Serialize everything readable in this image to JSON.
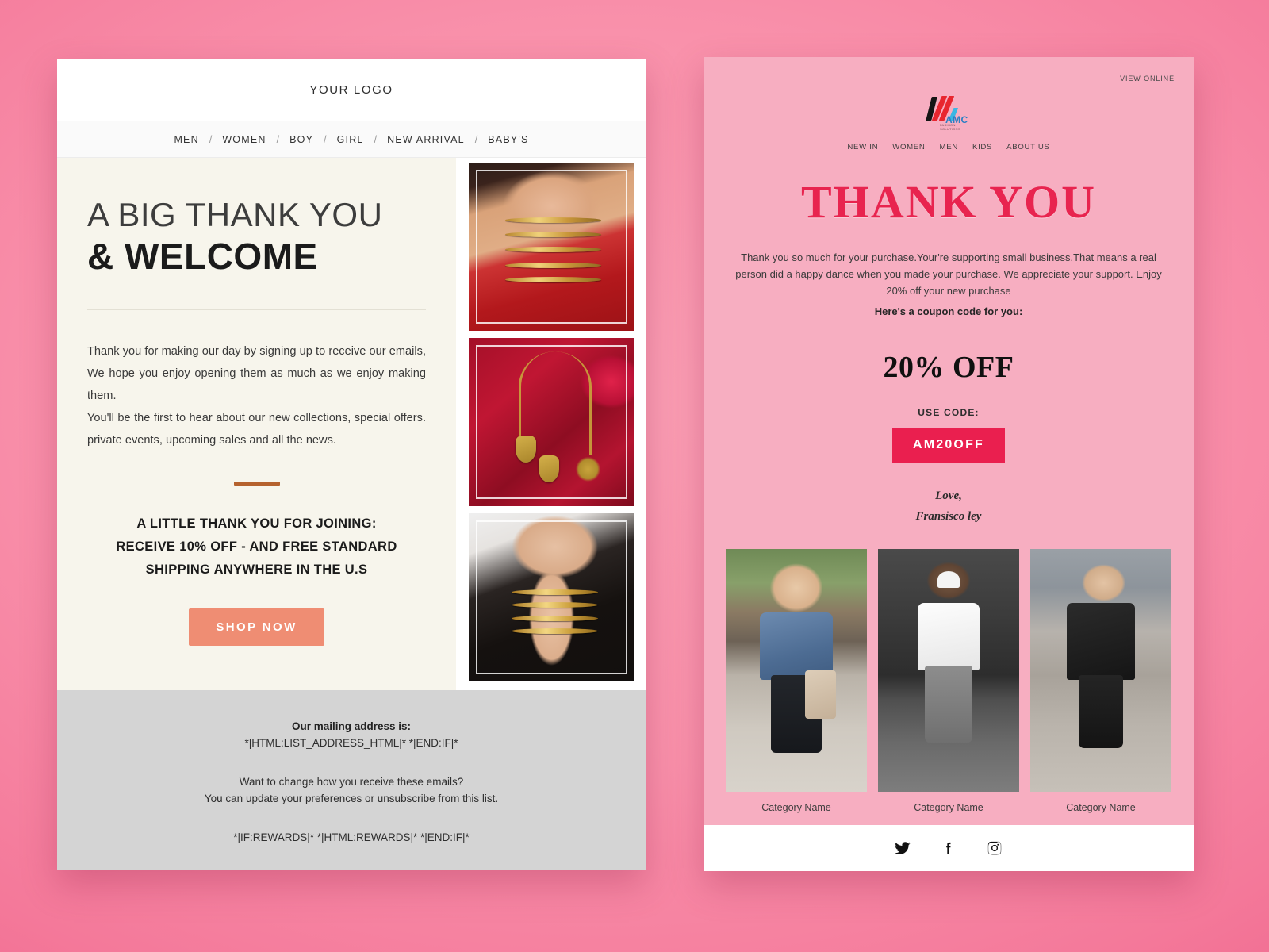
{
  "left_email": {
    "logo_text": "YOUR LOGO",
    "nav": [
      {
        "label": "MEN"
      },
      {
        "label": "WOMEN"
      },
      {
        "label": "BOY"
      },
      {
        "label": "GIRL"
      },
      {
        "label": "NEW ARRIVAL"
      },
      {
        "label": "BABY'S"
      }
    ],
    "nav_separator": "/",
    "headline_line1": "A BIG THANK YOU",
    "headline_line2": "& WELCOME",
    "paragraph_1": "Thank you for making our day by signing up to receive our emails, We hope you enjoy opening them as much as we enjoy making them.",
    "paragraph_2": "You'll be the first to hear about our new collections, special offers. private events, upcoming sales and all the news.",
    "offer_line1": "A LITTLE THANK YOU FOR JOINING:",
    "offer_line2": "RECEIVE 10% OFF - AND FREE STANDARD",
    "offer_line3": "SHIPPING ANYWHERE IN THE U.S",
    "shop_button": "SHOP NOW",
    "thumbnails": [
      {
        "alt": "gold-layered-necklace-red-dress"
      },
      {
        "alt": "indian-kundan-jewellery-set"
      },
      {
        "alt": "gold-chain-necklace-black-blazer"
      }
    ],
    "footer": {
      "mailing_label": "Our mailing address is:",
      "address_merge_tag": "*|HTML:LIST_ADDRESS_HTML|* *|END:IF|*",
      "pref_line1": "Want to change how you receive these emails?",
      "pref_line2": "You can update your preferences or unsubscribe from this list.",
      "rewards_merge_tag": "*|IF:REWARDS|* *|HTML:REWARDS|* *|END:IF|*"
    }
  },
  "right_email": {
    "view_online": "VIEW ONLINE",
    "brand_name": "AMC",
    "brand_tagline": "FASHION SOLUTIONS",
    "nav": [
      {
        "label": "NEW IN"
      },
      {
        "label": "WOMEN"
      },
      {
        "label": "MEN"
      },
      {
        "label": "KIDS"
      },
      {
        "label": "ABOUT US"
      }
    ],
    "title": "THANK YOU",
    "body_line1": "Thank you so much for your purchase.Your're supporting small business.That",
    "body_line2": "means a real person did a happy dance when you made your purchase.",
    "body_line3": "We appreciate your support. Enjoy 20% off your new purchase",
    "body_strong": "Here's a coupon code for you:",
    "discount": "20% OFF",
    "use_code_label": "USE CODE:",
    "coupon_code": "AM20OFF",
    "sign_off": "Love,",
    "sign_name": "Fransisco ley",
    "categories": [
      {
        "label": "Category Name",
        "alt": "denim-jacket-street-style"
      },
      {
        "label": "Category Name",
        "alt": "white-tee-jogger-street-style"
      },
      {
        "label": "Category Name",
        "alt": "black-blazer-street-style"
      }
    ],
    "social": [
      {
        "name": "twitter"
      },
      {
        "name": "facebook"
      },
      {
        "name": "instagram"
      }
    ]
  },
  "colors": {
    "background_pink": "#f9a0b7",
    "cream_panel": "#f7f5ec",
    "shop_button": "#ef8d73",
    "divider_brown": "#b5622e",
    "right_panel_pink": "#f7aec1",
    "thank_you_red": "#e8244f",
    "coupon_badge": "#ea1f4f",
    "footer_gray": "#d4d4d4"
  }
}
